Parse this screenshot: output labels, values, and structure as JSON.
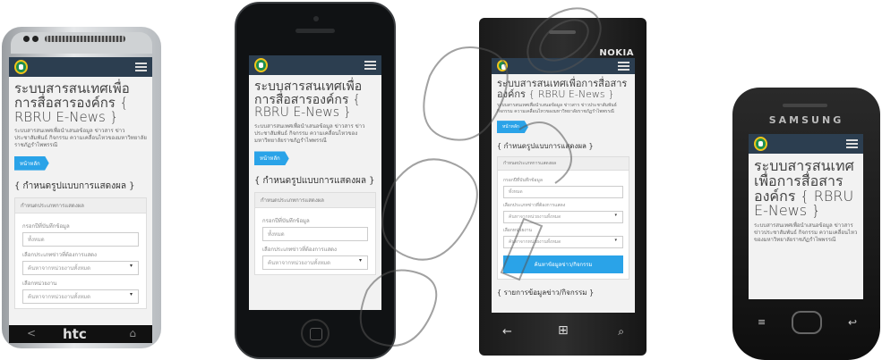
{
  "site": {
    "title": "ระบบสารสนเทศเพื่อการสื่อสารองค์กร { RBRU E-News }",
    "description": "ระบบสารสนเทศเพื่อนำเสนอข้อมูล ข่าวสาร ข่าวประชาสัมพันธ์ กิจกรรม ความเคลื่อนไหวของมหาวิทยาลัยราชภัฏรำไพพรรณี",
    "home_crumb": "หน้าหลัก",
    "section_display": "{ กำหนดรูปแบบการแสดงผล }",
    "panel_heading": "กำหนดประเภทการแสดงผล",
    "label_year": "กรอกปีที่บันทึกข้อมูล",
    "input_year_value": "ทั้งหมด",
    "label_type": "เลือกประเภทข่าวที่ต้องการแสดง",
    "select_type_value": "ค้นหาจากหน่วยงานทั้งหมด",
    "label_agency": "เลือกหน่วยงาน",
    "select_agency_value": "ค้นหาจากหน่วยงานทั้งหมด",
    "search_button": "ค้นหาข้อมูลข่าว/กิจกรรม",
    "section_list": "{ รายการข้อมูลข่าว/กิจกรรม }"
  },
  "devices": {
    "htc_brand": "htc",
    "htc_back": "<",
    "htc_home": "⌂",
    "nokia_brand": "NOKIA",
    "nokia_back": "←",
    "nokia_start": "⊞",
    "nokia_search": "⌕",
    "samsung_brand": "SAMSUNG",
    "samsung_menu": "≡",
    "samsung_back": "↩"
  },
  "colors": {
    "navbar": "#2c3e50",
    "accent": "#2aa3e8"
  }
}
